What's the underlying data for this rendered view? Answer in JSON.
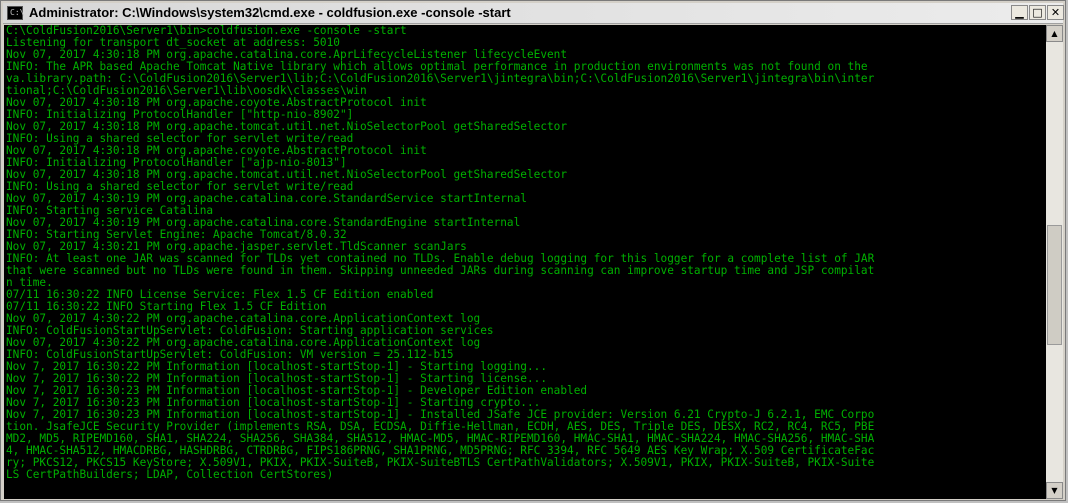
{
  "window": {
    "title": "Administrator: C:\\Windows\\system32\\cmd.exe - coldfusion.exe  -console -start",
    "icon_label": "C:\\",
    "minimize_glyph": "▁",
    "maximize_glyph": "□",
    "close_glyph": "✕"
  },
  "scrollbar": {
    "up_glyph": "▲",
    "down_glyph": "▼"
  },
  "colors": {
    "console_text": "#00b000",
    "console_bg": "#000000"
  },
  "console": {
    "lines": [
      "C:\\ColdFusion2016\\Server1\\bin>coldfusion.exe -console -start",
      "Listening for transport dt_socket at address: 5010",
      "Nov 07, 2017 4:30:18 PM org.apache.catalina.core.AprLifecycleListener lifecycleEvent",
      "INFO: The APR based Apache Tomcat Native library which allows optimal performance in production environments was not found on the",
      "va.library.path: C:\\ColdFusion2016\\Server1\\lib;C:\\ColdFusion2016\\Server1\\jintegra\\bin;C:\\ColdFusion2016\\Server1\\jintegra\\bin\\inter",
      "tional;C:\\ColdFusion2016\\Server1\\lib\\oosdk\\classes\\win",
      "Nov 07, 2017 4:30:18 PM org.apache.coyote.AbstractProtocol init",
      "INFO: Initializing ProtocolHandler [\"http-nio-8902\"]",
      "Nov 07, 2017 4:30:18 PM org.apache.tomcat.util.net.NioSelectorPool getSharedSelector",
      "INFO: Using a shared selector for servlet write/read",
      "Nov 07, 2017 4:30:18 PM org.apache.coyote.AbstractProtocol init",
      "INFO: Initializing ProtocolHandler [\"ajp-nio-8013\"]",
      "Nov 07, 2017 4:30:18 PM org.apache.tomcat.util.net.NioSelectorPool getSharedSelector",
      "INFO: Using a shared selector for servlet write/read",
      "Nov 07, 2017 4:30:19 PM org.apache.catalina.core.StandardService startInternal",
      "INFO: Starting service Catalina",
      "Nov 07, 2017 4:30:19 PM org.apache.catalina.core.StandardEngine startInternal",
      "INFO: Starting Servlet Engine: Apache Tomcat/8.0.32",
      "Nov 07, 2017 4:30:21 PM org.apache.jasper.servlet.TldScanner scanJars",
      "INFO: At least one JAR was scanned for TLDs yet contained no TLDs. Enable debug logging for this logger for a complete list of JAR",
      "that were scanned but no TLDs were found in them. Skipping unneeded JARs during scanning can improve startup time and JSP compilat",
      "n time.",
      "07/11 16:30:22 INFO License Service: Flex 1.5 CF Edition enabled",
      "07/11 16:30:22 INFO Starting Flex 1.5 CF Edition",
      "Nov 07, 2017 4:30:22 PM org.apache.catalina.core.ApplicationContext log",
      "INFO: ColdFusionStartUpServlet: ColdFusion: Starting application services",
      "Nov 07, 2017 4:30:22 PM org.apache.catalina.core.ApplicationContext log",
      "INFO: ColdFusionStartUpServlet: ColdFusion: VM version = 25.112-b15",
      "Nov 7, 2017 16:30:22 PM Information [localhost-startStop-1] - Starting logging...",
      "Nov 7, 2017 16:30:22 PM Information [localhost-startStop-1] - Starting license...",
      "Nov 7, 2017 16:30:23 PM Information [localhost-startStop-1] - Developer Edition enabled",
      "Nov 7, 2017 16:30:23 PM Information [localhost-startStop-1] - Starting crypto...",
      "Nov 7, 2017 16:30:23 PM Information [localhost-startStop-1] - Installed JSafe JCE provider: Version 6.21 Crypto-J 6.2.1, EMC Corpo",
      "tion. JsafeJCE Security Provider (implements RSA, DSA, ECDSA, Diffie-Hellman, ECDH, AES, DES, Triple DES, DESX, RC2, RC4, RC5, PBE",
      "MD2, MD5, RIPEMD160, SHA1, SHA224, SHA256, SHA384, SHA512, HMAC-MD5, HMAC-RIPEMD160, HMAC-SHA1, HMAC-SHA224, HMAC-SHA256, HMAC-SHA",
      "4, HMAC-SHA512, HMACDRBG, HASHDRBG, CTRDRBG, FIPS186PRNG, SHA1PRNG, MD5PRNG; RFC 3394, RFC 5649 AES Key Wrap; X.509 CertificateFac",
      "ry; PKCS12, PKCS15 KeyStore; X.509V1, PKIX, PKIX-SuiteB, PKIX-SuiteBTLS CertPathValidators; X.509V1, PKIX, PKIX-SuiteB, PKIX-Suite",
      "LS CertPathBuilders; LDAP, Collection CertStores)"
    ]
  }
}
